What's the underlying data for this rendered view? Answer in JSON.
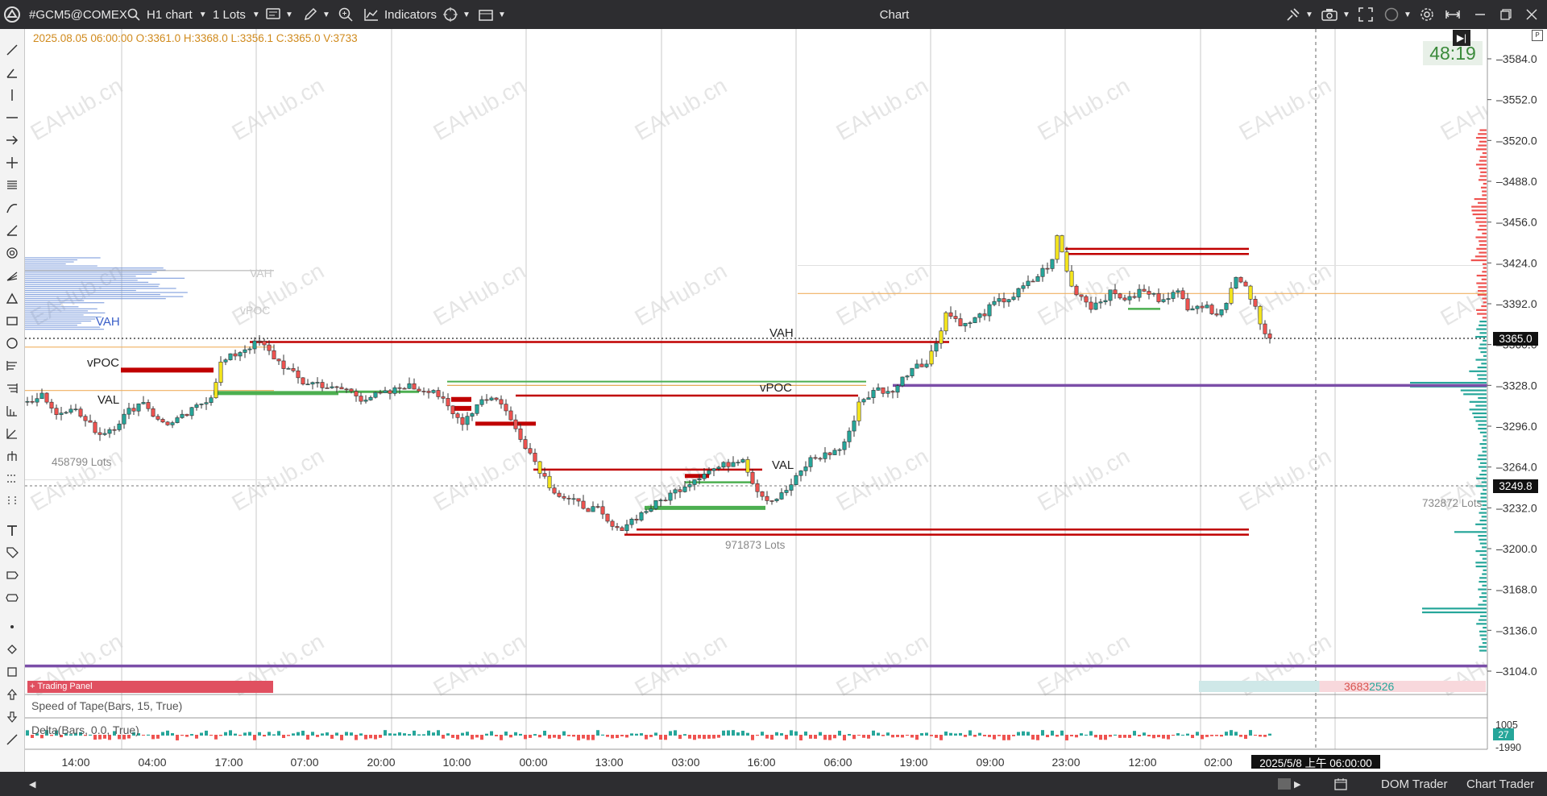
{
  "titlebar": {
    "symbol": "#GCM5@COMEX",
    "timeframe": "H1 chart",
    "lot_size": "1 Lots",
    "indicators_label": "Indicators",
    "window_title": "Chart",
    "icons": [
      "app-logo-icon",
      "search-icon",
      "chevron-down-icon",
      "order-icon",
      "pen-icon",
      "zoom-in-icon",
      "indicators-icon",
      "crosshair-icon",
      "template-icon",
      "pin-icon",
      "camera-icon",
      "fullscreen-icon",
      "circle-icon",
      "settings-icon",
      "minimize-icon",
      "restore-icon",
      "close-icon"
    ]
  },
  "ohlc_text": "2025.08.05 06:00:00 O:3361.0 H:3368.0 L:3356.1 C:3365.0 V:3733",
  "timer": "48:19",
  "price_axis": {
    "ticks": [
      "3584.0",
      "3552.0",
      "3520.0",
      "3488.0",
      "3456.0",
      "3424.0",
      "3392.0",
      "3360.0",
      "3328.0",
      "3296.0",
      "3264.0",
      "3232.0",
      "3200.0",
      "3168.0",
      "3136.0",
      "3104.0"
    ],
    "current_price": "3365.0",
    "crosshair_price": "3249.8"
  },
  "time_axis": {
    "ticks": [
      "14:00",
      "04:00",
      "17:00",
      "07:00",
      "20:00",
      "10:00",
      "00:00",
      "13:00",
      "03:00",
      "16:00",
      "06:00",
      "19:00",
      "09:00",
      "23:00",
      "12:00",
      "02:00"
    ],
    "crosshair_time": "2025/5/8 上午 06:00:00"
  },
  "profile_labels": {
    "vah_left": "VAH",
    "vpoc_left": "vPOC",
    "val_left": "VAL",
    "vah_ghost": "VAH",
    "vpoc_ghost": "vPOC",
    "vah_mid": "VAH",
    "vpoc_mid": "vPOC",
    "val_mid": "VAL"
  },
  "lots_labels": {
    "left": "458799 Lots",
    "mid": "971873 Lots",
    "right": "732872 Lots"
  },
  "bottom_panel": {
    "speed_of_tape": "Speed of Tape(Bars, 15, True)",
    "delta": "Delta(Bars, 0.0, True)",
    "delta_scale_top": "1005",
    "delta_scale_bottom": "-1990",
    "delta_badge": "27",
    "bar_tag_left": "Trading Panel",
    "bar_tag_value": "3683",
    "bar_tag_value2": "2526"
  },
  "statusbar": {
    "dom_trader": "DOM Trader",
    "chart_trader": "Chart Trader"
  },
  "watermark": "EAHub.cn",
  "colors": {
    "bull": "#26a69a",
    "bear": "#ef5350",
    "highlight": "#f5e61e",
    "val_line": "#c00000",
    "vpoc_line": "#4caf50",
    "purple_line": "#7b4ea8"
  },
  "chart_data": {
    "type": "candlestick",
    "x_ticks": [
      "14:00",
      "04:00",
      "17:00",
      "07:00",
      "20:00",
      "10:00",
      "00:00",
      "13:00",
      "03:00",
      "16:00",
      "06:00",
      "19:00",
      "09:00",
      "23:00",
      "12:00",
      "02:00"
    ],
    "ylim": [
      3090,
      3600
    ],
    "last_close": 3365.0,
    "path": [
      [
        0,
        3315
      ],
      [
        3,
        3322
      ],
      [
        6,
        3305
      ],
      [
        9,
        3312
      ],
      [
        12,
        3300
      ],
      [
        15,
        3290
      ],
      [
        18,
        3296
      ],
      [
        21,
        3308
      ],
      [
        24,
        3316
      ],
      [
        27,
        3300
      ],
      [
        30,
        3298
      ],
      [
        33,
        3305
      ],
      [
        38,
        3320
      ],
      [
        40,
        3345
      ],
      [
        42,
        3350
      ],
      [
        45,
        3357
      ],
      [
        48,
        3362
      ],
      [
        51,
        3350
      ],
      [
        54,
        3340
      ],
      [
        57,
        3330
      ],
      [
        60,
        3330
      ],
      [
        63,
        3325
      ],
      [
        66,
        3325
      ],
      [
        69,
        3318
      ],
      [
        72,
        3320
      ],
      [
        75,
        3322
      ],
      [
        78,
        3328
      ],
      [
        81,
        3325
      ],
      [
        84,
        3325
      ],
      [
        86,
        3315
      ],
      [
        88,
        3305
      ],
      [
        90,
        3300
      ],
      [
        92,
        3308
      ],
      [
        94,
        3318
      ],
      [
        96,
        3318
      ],
      [
        98,
        3315
      ],
      [
        100,
        3300
      ],
      [
        102,
        3288
      ],
      [
        104,
        3275
      ],
      [
        106,
        3262
      ],
      [
        108,
        3250
      ],
      [
        110,
        3242
      ],
      [
        112,
        3238
      ],
      [
        114,
        3235
      ],
      [
        116,
        3232
      ],
      [
        118,
        3230
      ],
      [
        120,
        3220
      ],
      [
        122,
        3214
      ],
      [
        124,
        3220
      ],
      [
        126,
        3225
      ],
      [
        128,
        3230
      ],
      [
        132,
        3240
      ],
      [
        136,
        3250
      ],
      [
        140,
        3260
      ],
      [
        144,
        3265
      ],
      [
        148,
        3272
      ],
      [
        150,
        3252
      ],
      [
        152,
        3242
      ],
      [
        154,
        3238
      ],
      [
        156,
        3242
      ],
      [
        158,
        3250
      ],
      [
        160,
        3260
      ],
      [
        162,
        3270
      ],
      [
        164,
        3272
      ],
      [
        166,
        3275
      ],
      [
        168,
        3278
      ],
      [
        170,
        3290
      ],
      [
        172,
        3315
      ],
      [
        174,
        3320
      ],
      [
        176,
        3325
      ],
      [
        178,
        3322
      ],
      [
        180,
        3328
      ],
      [
        182,
        3338
      ],
      [
        184,
        3346
      ],
      [
        186,
        3345
      ],
      [
        188,
        3362
      ],
      [
        190,
        3385
      ],
      [
        192,
        3380
      ],
      [
        194,
        3375
      ],
      [
        196,
        3380
      ],
      [
        198,
        3385
      ],
      [
        200,
        3392
      ],
      [
        202,
        3395
      ],
      [
        204,
        3398
      ],
      [
        206,
        3405
      ],
      [
        208,
        3410
      ],
      [
        210,
        3418
      ],
      [
        212,
        3425
      ],
      [
        213,
        3445
      ],
      [
        214,
        3432
      ],
      [
        216,
        3405
      ],
      [
        218,
        3398
      ],
      [
        220,
        3390
      ],
      [
        222,
        3395
      ],
      [
        224,
        3400
      ],
      [
        226,
        3398
      ],
      [
        228,
        3395
      ],
      [
        230,
        3402
      ],
      [
        232,
        3400
      ],
      [
        234,
        3396
      ],
      [
        236,
        3399
      ],
      [
        238,
        3400
      ],
      [
        240,
        3390
      ],
      [
        242,
        3392
      ],
      [
        244,
        3388
      ],
      [
        246,
        3386
      ],
      [
        248,
        3392
      ],
      [
        250,
        3415
      ],
      [
        252,
        3406
      ],
      [
        254,
        3390
      ],
      [
        256,
        3368
      ],
      [
        257,
        3365
      ]
    ]
  }
}
